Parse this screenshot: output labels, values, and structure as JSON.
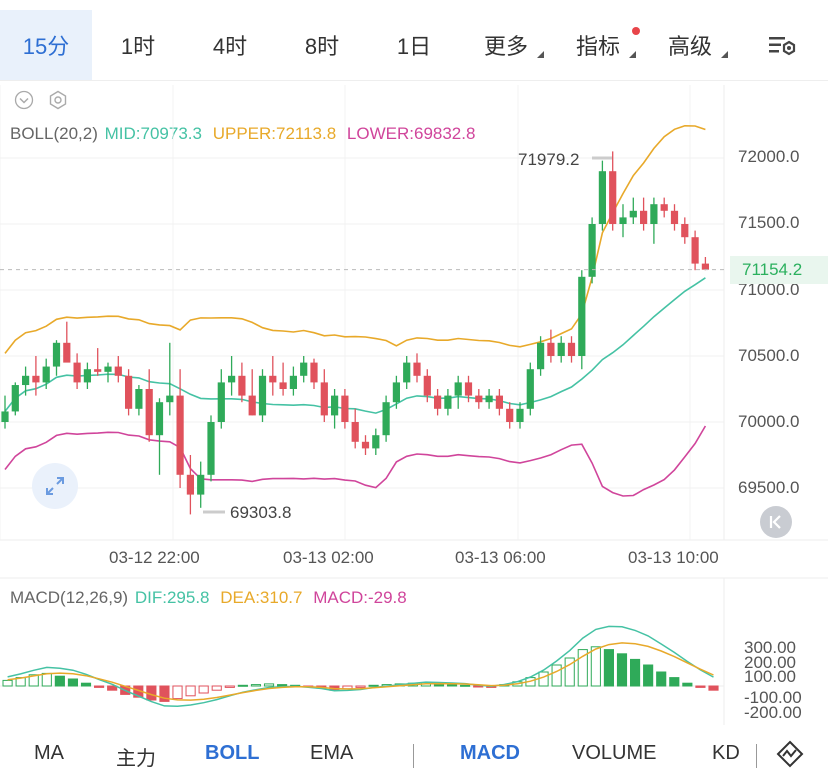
{
  "tabs": [
    {
      "label": "15分",
      "active": true,
      "dropdown": false
    },
    {
      "label": "1时",
      "active": false,
      "dropdown": false
    },
    {
      "label": "4时",
      "active": false,
      "dropdown": false
    },
    {
      "label": "8时",
      "active": false,
      "dropdown": false
    },
    {
      "label": "1日",
      "active": false,
      "dropdown": false
    },
    {
      "label": "更多",
      "active": false,
      "dropdown": true
    },
    {
      "label": "指标",
      "active": false,
      "dropdown": true,
      "badge": true
    },
    {
      "label": "高级",
      "active": false,
      "dropdown": true
    }
  ],
  "toolbar_icon": "chart-settings-icon",
  "boll": {
    "label": "BOLL(20,2)",
    "mid": "MID:70973.3",
    "upper": "UPPER:72113.8",
    "lower": "LOWER:69832.8",
    "colors": {
      "mid": "#45c2a4",
      "upper": "#e8a92a",
      "lower": "#d0459b"
    }
  },
  "price_axis": [
    "72000.0",
    "71500.0",
    "71000.0",
    "70500.0",
    "70000.0",
    "69500.0"
  ],
  "current_price": "71154.2",
  "high_label": "71979.2",
  "low_label": "69303.8",
  "time_axis": [
    "03-12 22:00",
    "03-13 02:00",
    "03-13 06:00",
    "03-13 10:00"
  ],
  "macd": {
    "label": "MACD(12,26,9)",
    "dif": "DIF:295.8",
    "dea": "DEA:310.7",
    "macd": "MACD:-29.8",
    "axis": [
      "300.00",
      "200.00",
      "100.00",
      "-100.00",
      "-200.00"
    ]
  },
  "bottom_tabs": [
    {
      "label": "MA",
      "active": false
    },
    {
      "label": "主力",
      "active": false
    },
    {
      "label": "BOLL",
      "active": true
    },
    {
      "label": "EMA",
      "active": false
    },
    {
      "label": "MACD",
      "active": true
    },
    {
      "label": "VOLUME",
      "active": false
    },
    {
      "label": "KD",
      "active": false
    }
  ],
  "colors": {
    "up": "#2faa59",
    "down": "#e0525c",
    "accent": "#2e6fd3"
  },
  "chart_data": {
    "type": "candlestick",
    "price_ylim": [
      69200,
      72200
    ],
    "candles_ohlc": [
      [
        70000,
        70200,
        69950,
        70080
      ],
      [
        70080,
        70300,
        70050,
        70280
      ],
      [
        70280,
        70420,
        70200,
        70350
      ],
      [
        70350,
        70500,
        70200,
        70300
      ],
      [
        70300,
        70480,
        70250,
        70420
      ],
      [
        70420,
        70620,
        70350,
        70600
      ],
      [
        70600,
        70760,
        70550,
        70450
      ],
      [
        70450,
        70520,
        70250,
        70300
      ],
      [
        70300,
        70450,
        70250,
        70400
      ],
      [
        70400,
        70560,
        70350,
        70380
      ],
      [
        70380,
        70450,
        70300,
        70420
      ],
      [
        70420,
        70500,
        70300,
        70350
      ],
      [
        70350,
        70400,
        70050,
        70100
      ],
      [
        70100,
        70280,
        70050,
        70250
      ],
      [
        70250,
        70400,
        69850,
        69900
      ],
      [
        69900,
        70180,
        69600,
        70150
      ],
      [
        70150,
        70600,
        70050,
        70200
      ],
      [
        70200,
        70400,
        69500,
        69600
      ],
      [
        69600,
        69750,
        69300,
        69450
      ],
      [
        69450,
        69700,
        69350,
        69600
      ],
      [
        69600,
        70050,
        69550,
        70000
      ],
      [
        70000,
        70400,
        69950,
        70300
      ],
      [
        70300,
        70500,
        70200,
        70350
      ],
      [
        70350,
        70450,
        70150,
        70200
      ],
      [
        70200,
        70400,
        70050,
        70050
      ],
      [
        70050,
        70400,
        70000,
        70350
      ],
      [
        70350,
        70500,
        70200,
        70300
      ],
      [
        70300,
        70450,
        70200,
        70250
      ],
      [
        70250,
        70420,
        70200,
        70350
      ],
      [
        70350,
        70500,
        70300,
        70450
      ],
      [
        70450,
        70480,
        70250,
        70300
      ],
      [
        70300,
        70400,
        70000,
        70050
      ],
      [
        70050,
        70250,
        69950,
        70200
      ],
      [
        70200,
        70250,
        69950,
        70000
      ],
      [
        70000,
        70100,
        69800,
        69850
      ],
      [
        69850,
        69900,
        69750,
        69800
      ],
      [
        69800,
        69950,
        69750,
        69900
      ],
      [
        69900,
        70200,
        69850,
        70150
      ],
      [
        70150,
        70350,
        70100,
        70300
      ],
      [
        70300,
        70500,
        70250,
        70450
      ],
      [
        70450,
        70520,
        70300,
        70350
      ],
      [
        70350,
        70400,
        70150,
        70200
      ],
      [
        70200,
        70250,
        70050,
        70100
      ],
      [
        70100,
        70250,
        70050,
        70200
      ],
      [
        70200,
        70350,
        70100,
        70300
      ],
      [
        70300,
        70350,
        70150,
        70200
      ],
      [
        70200,
        70250,
        70100,
        70150
      ],
      [
        70150,
        70250,
        70100,
        70200
      ],
      [
        70200,
        70250,
        70050,
        70100
      ],
      [
        70100,
        70150,
        69950,
        70000
      ],
      [
        70000,
        70150,
        69950,
        70100
      ],
      [
        70100,
        70450,
        70050,
        70400
      ],
      [
        70400,
        70650,
        70350,
        70600
      ],
      [
        70600,
        70700,
        70450,
        70500
      ],
      [
        70500,
        70650,
        70450,
        70600
      ],
      [
        70600,
        70650,
        70450,
        70500
      ],
      [
        70500,
        71150,
        70400,
        71100
      ],
      [
        71100,
        71550,
        71050,
        71500
      ],
      [
        71500,
        71980,
        71450,
        71900
      ],
      [
        71900,
        72050,
        71450,
        71500
      ],
      [
        71500,
        71650,
        71400,
        71550
      ],
      [
        71550,
        71700,
        71500,
        71600
      ],
      [
        71600,
        71700,
        71450,
        71500
      ],
      [
        71500,
        71700,
        71350,
        71650
      ],
      [
        71650,
        71700,
        71550,
        71600
      ],
      [
        71600,
        71650,
        71450,
        71500
      ],
      [
        71500,
        71550,
        71350,
        71400
      ],
      [
        71400,
        71450,
        71150,
        71200
      ],
      [
        71200,
        71250,
        71150,
        71154
      ]
    ],
    "macd_ylim": [
      -250,
      350
    ],
    "macd_hist": [
      40,
      60,
      80,
      90,
      70,
      50,
      20,
      -10,
      -30,
      -60,
      -80,
      -100,
      -110,
      -90,
      -70,
      -50,
      -30,
      -10,
      5,
      10,
      15,
      10,
      5,
      -5,
      -15,
      -30,
      -20,
      -10,
      5,
      10,
      15,
      20,
      25,
      15,
      10,
      5,
      -5,
      -10,
      10,
      30,
      60,
      100,
      150,
      200,
      260,
      280,
      260,
      230,
      190,
      150,
      100,
      60,
      20,
      -10,
      -30
    ]
  }
}
